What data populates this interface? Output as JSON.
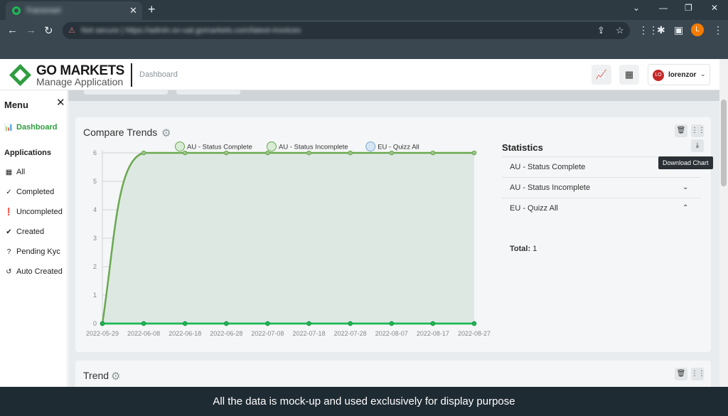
{
  "browser": {
    "tab_title": "Transmart",
    "url": "https://admin.sv-uat.gomarkets.com/latest-invoices",
    "security_label": "Not secure",
    "profile_initial": "L"
  },
  "app": {
    "brand": "GO MARKETS",
    "brand_sub": "Manage Application",
    "breadcrumb": "Dashboard",
    "user_initials": "LO",
    "user_name": "lorenzor"
  },
  "menu": {
    "title": "Menu",
    "dashboard": "Dashboard",
    "section_title": "Applications",
    "items": [
      {
        "label": "All",
        "icon": "table-icon"
      },
      {
        "label": "Completed",
        "icon": "check-icon"
      },
      {
        "label": "Uncompleted",
        "icon": "alert-icon"
      },
      {
        "label": "Created",
        "icon": "check-circle-icon"
      },
      {
        "label": "Pending Kyc",
        "icon": "question-icon"
      },
      {
        "label": "Auto Created",
        "icon": "history-icon"
      }
    ]
  },
  "compare_trends": {
    "title": "Compare Trends",
    "statistics_title": "Statistics",
    "download_tooltip": "Download Chart",
    "rows": [
      "AU - Status Complete",
      "AU - Status Incomplete",
      "EU - Quizz All"
    ],
    "total_label": "Total:",
    "total_value": "1"
  },
  "trend_card": {
    "title": "Trend"
  },
  "colors": {
    "accent_green": "#2e9c3f",
    "line_green": "#6aa84f",
    "fill_green": "#dde8e3"
  },
  "chart_data": {
    "type": "line",
    "x": [
      "2022-05-29",
      "2022-06-08",
      "2022-06-18",
      "2022-06-28",
      "2022-07-08",
      "2022-07-18",
      "2022-07-28",
      "2022-08-07",
      "2022-08-17",
      "2022-08-27"
    ],
    "ylim": [
      0,
      6
    ],
    "yticks": [
      "0",
      "1",
      "2",
      "3",
      "4",
      "5",
      "6"
    ],
    "series": [
      {
        "name": "AU - Status Complete",
        "values": [
          0,
          6,
          6,
          6,
          6,
          6,
          6,
          6,
          6,
          6
        ]
      },
      {
        "name": "AU - Status Incomplete",
        "values": [
          0,
          0,
          0,
          0,
          0,
          0,
          0,
          0,
          0,
          0
        ]
      },
      {
        "name": "EU - Quizz All",
        "values": [
          0,
          0,
          0,
          0,
          0,
          0,
          0,
          0,
          0,
          0
        ]
      }
    ]
  },
  "caption": "All the data is mock-up and used exclusively for display purpose"
}
